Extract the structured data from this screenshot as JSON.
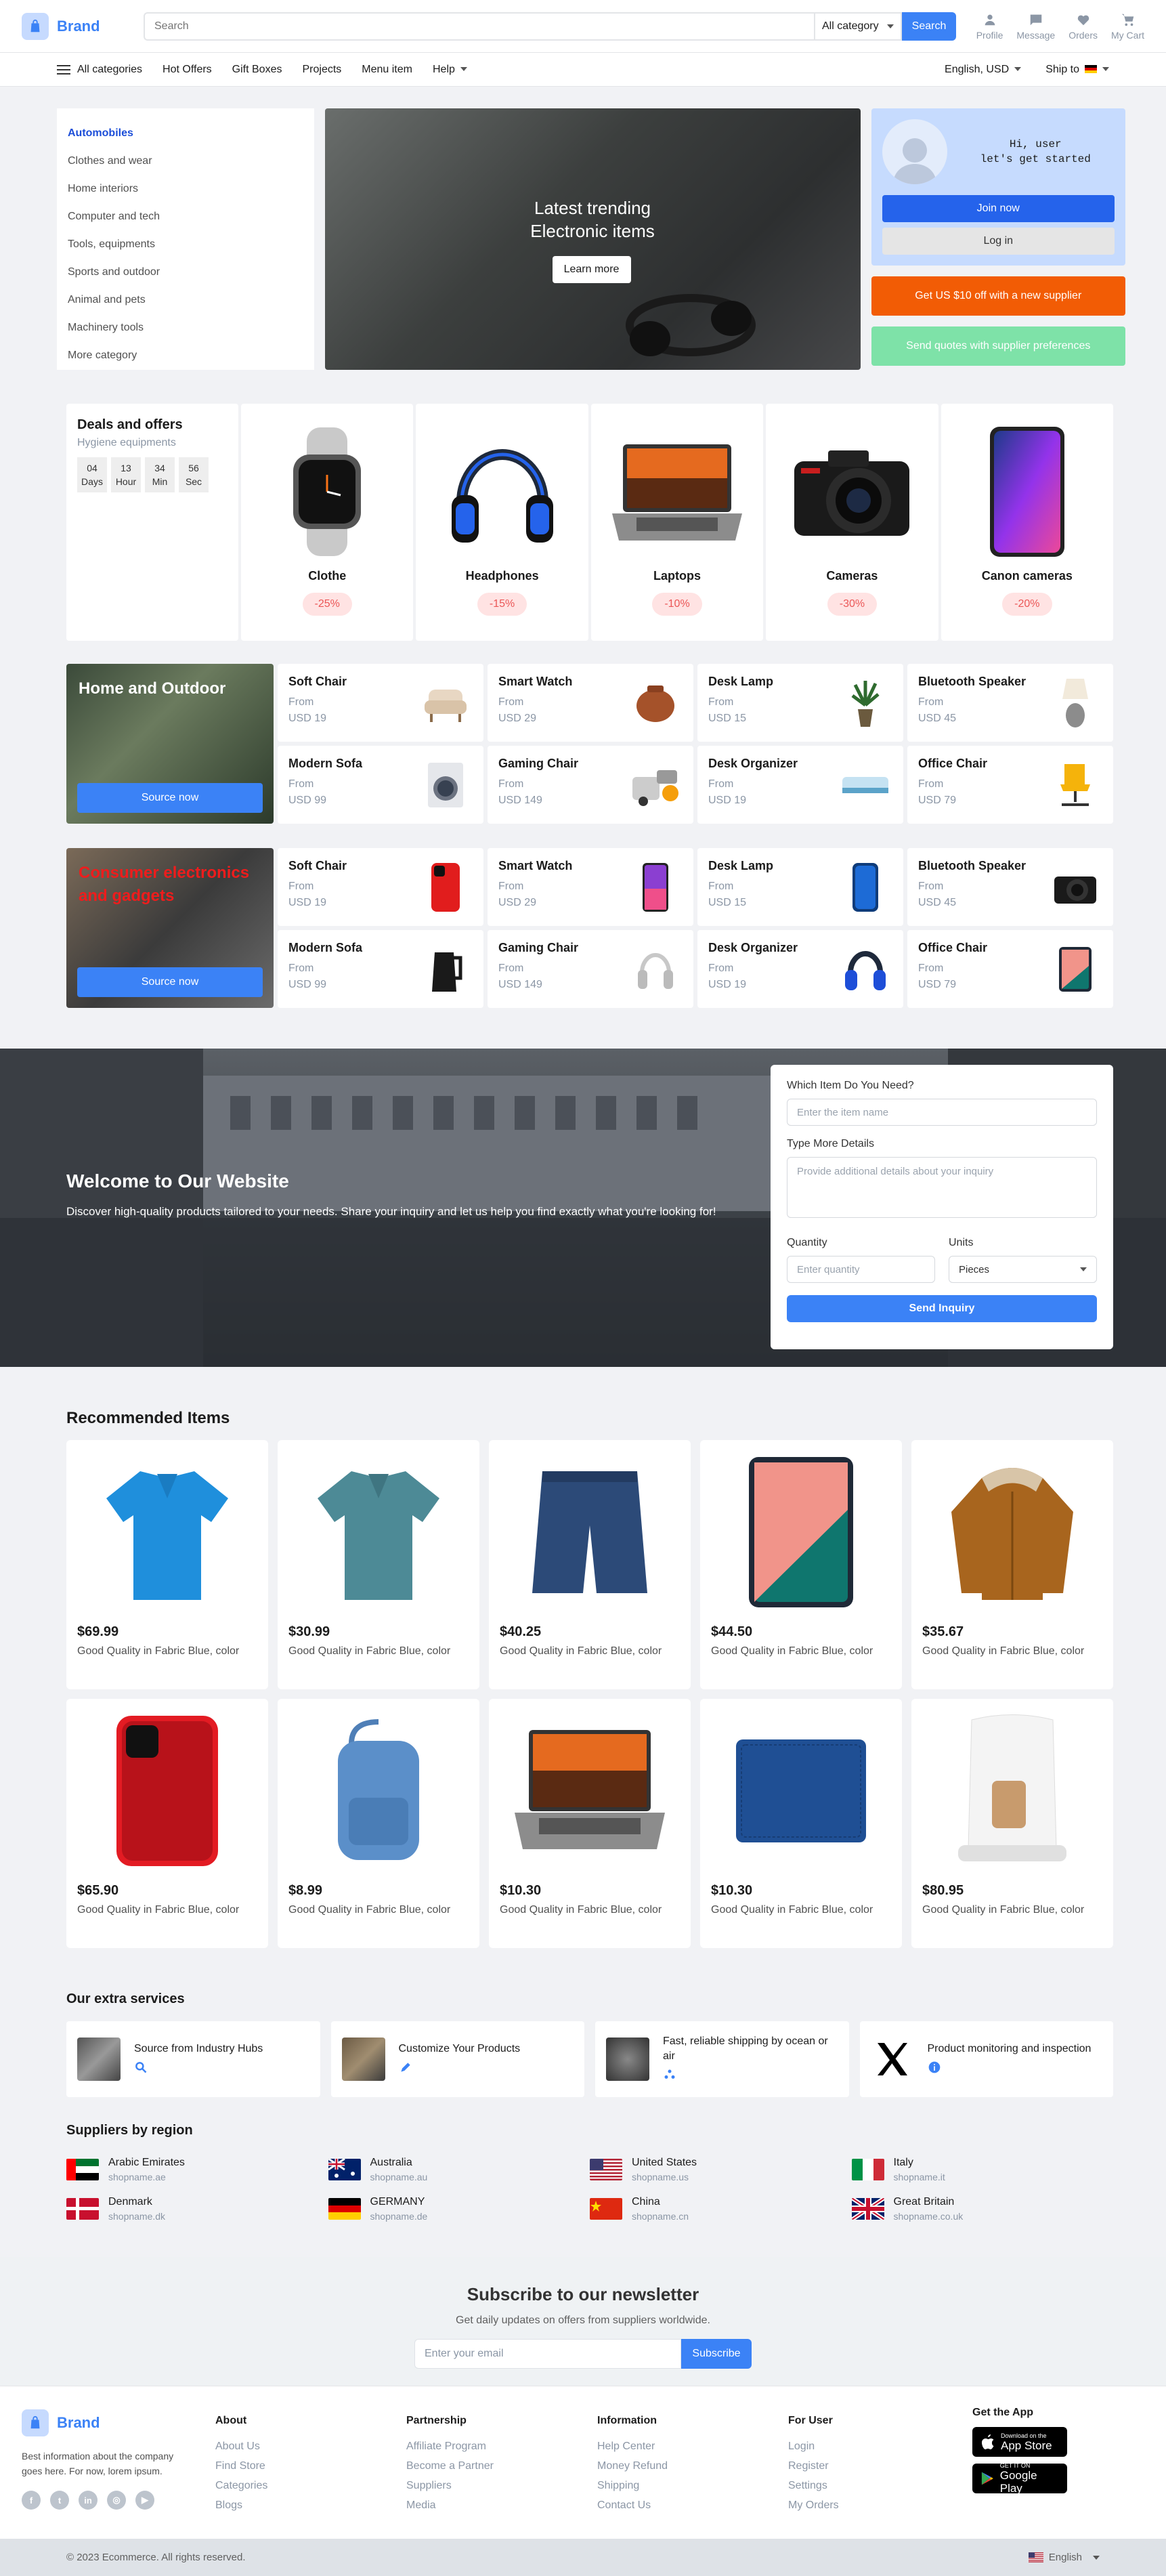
{
  "header": {
    "brand": "Brand",
    "search_placeholder": "Search",
    "category_select": "All category",
    "search_button": "Search",
    "actions": [
      {
        "label": "Profile",
        "icon": "profile-icon"
      },
      {
        "label": "Message",
        "icon": "message-icon"
      },
      {
        "label": "Orders",
        "icon": "heart-icon"
      },
      {
        "label": "My Cart",
        "icon": "cart-icon"
      }
    ]
  },
  "nav": {
    "all_categories": "All categories",
    "links": [
      "Hot Offers",
      "Gift Boxes",
      "Projects",
      "Menu item",
      "Help"
    ],
    "language": "English, USD",
    "ship_to": "Ship to"
  },
  "hero": {
    "categories": [
      "Automobiles",
      "Clothes and wear",
      "Home interiors",
      "Computer and tech",
      "Tools, equipments",
      "Sports and outdoor",
      "Animal and pets",
      "Machinery tools",
      "More category"
    ],
    "banner_line1": "Latest trending",
    "banner_line2": "Electronic items",
    "banner_button": "Learn more",
    "greeting_line1": "Hi, user",
    "greeting_line2": "let's get started",
    "join_button": "Join now",
    "login_button": "Log in",
    "promo_orange": "Get US $10 off with a new supplier",
    "promo_green": "Send quotes with supplier preferences",
    "colors": {
      "orange": "#f25c05",
      "green": "#7ee2a8"
    }
  },
  "deals": {
    "title": "Deals and offers",
    "subtitle": "Hygiene equipments",
    "timer": [
      {
        "value": "04",
        "unit": "Days"
      },
      {
        "value": "13",
        "unit": "Hour"
      },
      {
        "value": "34",
        "unit": "Min"
      },
      {
        "value": "56",
        "unit": "Sec"
      }
    ],
    "items": [
      {
        "name": "Clothe",
        "discount": "-25%"
      },
      {
        "name": "Headphones",
        "discount": "-15%"
      },
      {
        "name": "Laptops",
        "discount": "-10%"
      },
      {
        "name": "Cameras",
        "discount": "-30%"
      },
      {
        "name": "Canon cameras",
        "discount": "-20%"
      }
    ]
  },
  "home_outdoor": {
    "title": "Home and Outdoor",
    "button": "Source now",
    "items": [
      {
        "name": "Soft Chair",
        "from": "From",
        "price": "USD 19"
      },
      {
        "name": "Smart Watch",
        "from": "From",
        "price": "USD 29"
      },
      {
        "name": "Desk Lamp",
        "from": "From",
        "price": "USD 15"
      },
      {
        "name": "Bluetooth Speaker",
        "from": "From",
        "price": "USD 45"
      },
      {
        "name": "Modern Sofa",
        "from": "From",
        "price": "USD 99"
      },
      {
        "name": "Gaming Chair",
        "from": "From",
        "price": "USD 149"
      },
      {
        "name": "Desk Organizer",
        "from": "From",
        "price": "USD 19"
      },
      {
        "name": "Office Chair",
        "from": "From",
        "price": "USD 79"
      }
    ]
  },
  "electronics": {
    "title": "Consumer electronics and gadgets",
    "button": "Source now",
    "items": [
      {
        "name": "Soft Chair",
        "from": "From",
        "price": "USD 19"
      },
      {
        "name": "Smart Watch",
        "from": "From",
        "price": "USD 29"
      },
      {
        "name": "Desk Lamp",
        "from": "From",
        "price": "USD 15"
      },
      {
        "name": "Bluetooth Speaker",
        "from": "From",
        "price": "USD 45"
      },
      {
        "name": "Modern Sofa",
        "from": "From",
        "price": "USD 99"
      },
      {
        "name": "Gaming Chair",
        "from": "From",
        "price": "USD 149"
      },
      {
        "name": "Desk Organizer",
        "from": "From",
        "price": "USD 19"
      },
      {
        "name": "Office Chair",
        "from": "From",
        "price": "USD 79"
      }
    ]
  },
  "inquiry": {
    "title": "Welcome to Our Website",
    "text": "Discover high-quality products tailored to your needs. Share your inquiry and let us help you find exactly what you're looking for!",
    "item_label": "Which Item Do You Need?",
    "item_placeholder": "Enter the item name",
    "details_label": "Type More Details",
    "details_placeholder": "Provide additional details about your inquiry",
    "quantity_label": "Quantity",
    "quantity_placeholder": "Enter quantity",
    "units_label": "Units",
    "units_value": "Pieces",
    "send_button": "Send Inquiry"
  },
  "recommended": {
    "title": "Recommended Items",
    "items": [
      {
        "price": "$69.99",
        "desc": "Good Quality in Fabric Blue, color"
      },
      {
        "price": "$30.99",
        "desc": "Good Quality in Fabric Blue, color"
      },
      {
        "price": "$40.25",
        "desc": "Good Quality in Fabric Blue, color"
      },
      {
        "price": "$44.50",
        "desc": "Good Quality in Fabric Blue, color"
      },
      {
        "price": "$35.67",
        "desc": "Good Quality in Fabric Blue, color"
      },
      {
        "price": "$65.90",
        "desc": "Good Quality in Fabric Blue, color"
      },
      {
        "price": "$8.99",
        "desc": "Good Quality in Fabric Blue, color"
      },
      {
        "price": "$10.30",
        "desc": "Good Quality in Fabric Blue, color"
      },
      {
        "price": "$10.30",
        "desc": "Good Quality in Fabric Blue, color"
      },
      {
        "price": "$80.95",
        "desc": "Good Quality in Fabric Blue, color"
      }
    ]
  },
  "services": {
    "title": "Our extra services",
    "items": [
      {
        "label": "Source from Industry Hubs",
        "icon": "search-icon"
      },
      {
        "label": "Customize Your Products",
        "icon": "pencil-icon"
      },
      {
        "label": "Fast, reliable shipping by ocean or air",
        "icon": "ship-icon"
      },
      {
        "label": "Product monitoring and inspection",
        "icon": "info-icon"
      }
    ]
  },
  "regions": {
    "title": "Suppliers by region",
    "items": [
      {
        "country": "Arabic Emirates",
        "url": "shopname.ae"
      },
      {
        "country": "Australia",
        "url": "shopname.au"
      },
      {
        "country": "United States",
        "url": "shopname.us"
      },
      {
        "country": "Italy",
        "url": "shopname.it"
      },
      {
        "country": "Denmark",
        "url": "shopname.dk"
      },
      {
        "country": "GERMANY",
        "url": "shopname.de"
      },
      {
        "country": "China",
        "url": "shopname.cn"
      },
      {
        "country": "Great Britain",
        "url": "shopname.co.uk"
      }
    ]
  },
  "newsletter": {
    "title": "Subscribe to our newsletter",
    "subtitle": "Get daily updates on offers from suppliers worldwide.",
    "placeholder": "Enter your email",
    "button": "Subscribe"
  },
  "footer": {
    "brand": "Brand",
    "description": "Best information about the company goes here. For now, lorem ipsum.",
    "columns": [
      {
        "title": "About",
        "links": [
          "About Us",
          "Find Store",
          "Categories",
          "Blogs"
        ]
      },
      {
        "title": "Partnership",
        "links": [
          "Affiliate Program",
          "Become a Partner",
          "Suppliers",
          "Media"
        ]
      },
      {
        "title": "Information",
        "links": [
          "Help Center",
          "Money Refund",
          "Shipping",
          "Contact Us"
        ]
      },
      {
        "title": "For User",
        "links": [
          "Login",
          "Register",
          "Settings",
          "My Orders"
        ]
      }
    ],
    "app_title": "Get the App",
    "app_store_small": "Download on the",
    "app_store": "App Store",
    "google_small": "GET IT ON",
    "google_play": "Google Play",
    "copyright": "© 2023 Ecommerce. All rights reserved.",
    "language": "English"
  }
}
